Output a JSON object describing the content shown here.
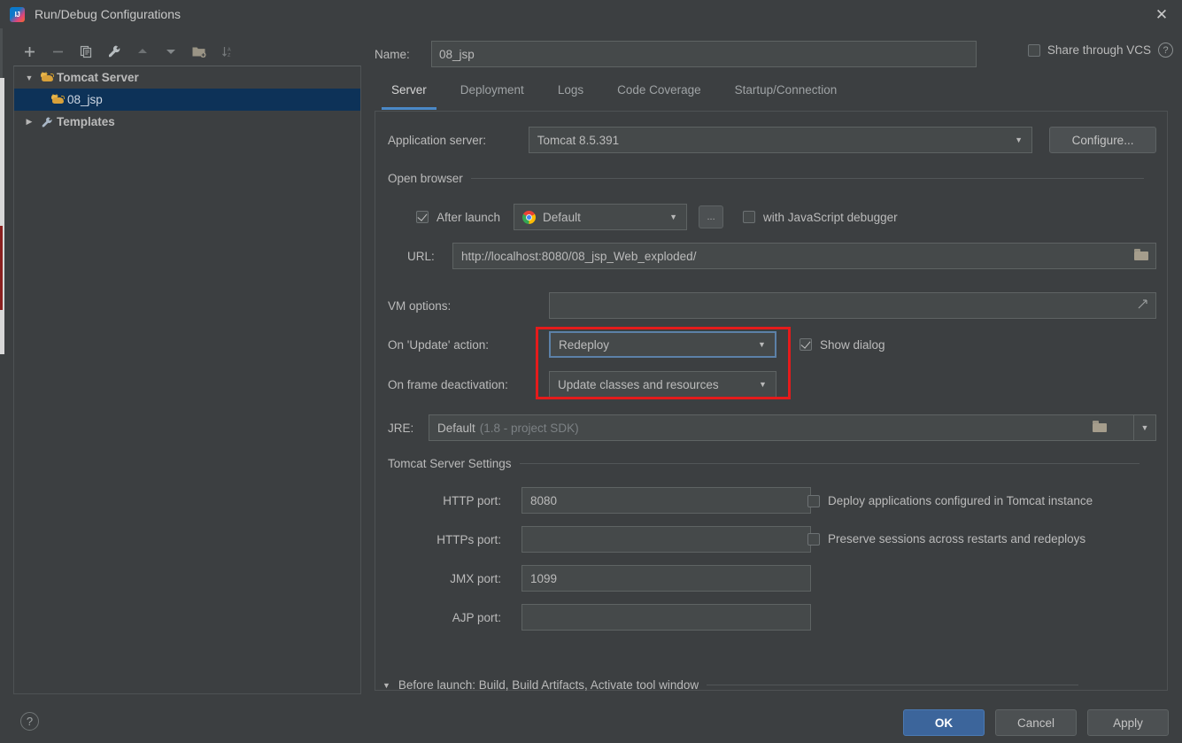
{
  "window": {
    "title": "Run/Debug Configurations",
    "app_icon": "intellij-idea-icon",
    "close_icon": "✕"
  },
  "sidebar": {
    "toolbar": [
      {
        "name": "add-configuration-button",
        "glyph": "+",
        "enabled": true
      },
      {
        "name": "remove-configuration-button",
        "glyph": "−",
        "enabled": false
      },
      {
        "name": "copy-configuration-button",
        "glyph": "❐",
        "enabled": true
      },
      {
        "name": "edit-templates-button",
        "glyph": "🔧",
        "enabled": true
      },
      {
        "name": "move-up-button",
        "glyph": "▲",
        "enabled": false
      },
      {
        "name": "move-down-button",
        "glyph": "▼",
        "enabled": false
      },
      {
        "name": "create-folder-button",
        "glyph": "📁",
        "enabled": true
      },
      {
        "name": "sort-configurations-button",
        "glyph": "↓AZ",
        "enabled": false
      }
    ],
    "tree": [
      {
        "label": "Tomcat Server",
        "icon": "tomcat-icon",
        "expanded": true,
        "selected": false,
        "level": 0
      },
      {
        "label": "08_jsp",
        "icon": "tomcat-icon",
        "expanded": null,
        "selected": true,
        "level": 1
      },
      {
        "label": "Templates",
        "icon": "wrench-icon",
        "expanded": false,
        "selected": false,
        "level": 0
      }
    ]
  },
  "header": {
    "name_label": "Name:",
    "name_value": "08_jsp",
    "share_label": "Share through VCS",
    "share_checked": false,
    "help_icon": "?"
  },
  "tabs": [
    {
      "label": "Server",
      "active": true
    },
    {
      "label": "Deployment",
      "active": false
    },
    {
      "label": "Logs",
      "active": false
    },
    {
      "label": "Code Coverage",
      "active": false
    },
    {
      "label": "Startup/Connection",
      "active": false
    }
  ],
  "server_tab": {
    "application_server": {
      "label": "Application server:",
      "value": "Tomcat 8.5.391",
      "configure_button": "Configure..."
    },
    "open_browser": {
      "group_title": "Open browser",
      "after_launch_label": "After launch",
      "after_launch_checked": true,
      "browser_value": "Default",
      "browser_icon": "chrome-icon",
      "browse_button": "...",
      "js_debugger_label": "with JavaScript debugger",
      "js_debugger_checked": false,
      "url_label": "URL:",
      "url_value": "http://localhost:8080/08_jsp_Web_exploded/"
    },
    "vm_options": {
      "label": "VM options:",
      "value": "",
      "expand_icon": "expand-icon"
    },
    "on_update_action": {
      "label": "On 'Update' action:",
      "value": "Redeploy",
      "focused": true,
      "show_dialog_label": "Show dialog",
      "show_dialog_checked": true
    },
    "on_frame_deactivation": {
      "label": "On frame deactivation:",
      "value": "Update classes and resources"
    },
    "jre": {
      "label": "JRE:",
      "value": "Default",
      "value_hint": "(1.8 - project SDK)",
      "browse_icon": "folder-icon",
      "dropdown_icon": "chevron-down-icon"
    },
    "tomcat_settings": {
      "group_title": "Tomcat Server Settings",
      "fields": [
        {
          "label": "HTTP port:",
          "value": "8080",
          "name": "http-port-input"
        },
        {
          "label": "HTTPs port:",
          "value": "",
          "name": "https-port-input"
        },
        {
          "label": "JMX port:",
          "value": "1099",
          "name": "jmx-port-input"
        },
        {
          "label": "AJP port:",
          "value": "",
          "name": "ajp-port-input"
        }
      ],
      "checkboxes": [
        {
          "label": "Deploy applications configured in Tomcat instance",
          "checked": false,
          "name": "deploy-applications-checkbox"
        },
        {
          "label": "Preserve sessions across restarts and redeploys",
          "checked": false,
          "name": "preserve-sessions-checkbox"
        }
      ]
    }
  },
  "before_launch": {
    "label": "Before launch: Build, Build Artifacts, Activate tool window",
    "expanded": true
  },
  "footer": {
    "help_icon": "?",
    "ok_label": "OK",
    "cancel_label": "Cancel",
    "apply_label": "Apply"
  },
  "annotation": {
    "color": "#e51b1b",
    "description": "red-highlight-box-around-update-action-and-frame-deactivation"
  },
  "colors": {
    "background": "#3c3f41",
    "field_background": "#45494a",
    "selection_blue": "#0d3258",
    "accent_blue": "#4a88c7",
    "primary_button": "#3c659b",
    "annotation_red": "#e51b1b"
  }
}
